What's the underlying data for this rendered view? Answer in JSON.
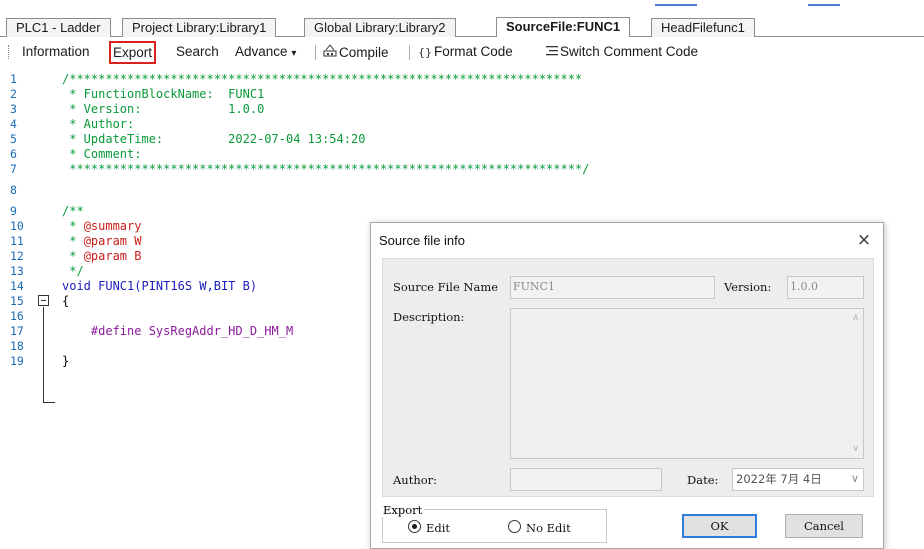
{
  "tabs": [
    {
      "label": "PLC1 - Ladder"
    },
    {
      "label": "Project Library:Library1"
    },
    {
      "label": "Global Library:Library2"
    },
    {
      "label": "SourceFile:FUNC1",
      "active": true
    },
    {
      "label": "HeadFilefunc1"
    }
  ],
  "toolbar": {
    "information": "Information",
    "export": "Export",
    "search": "Search",
    "advance": "Advance",
    "advance_caret": "▾",
    "compile": "Compile",
    "compile_icon": "compile-icon",
    "format_code": "Format Code",
    "format_icon": "format-code-icon",
    "switch_comment": "Switch Comment Code",
    "switch_icon": "switch-comment-icon",
    "highlight_color": "#d9221c"
  },
  "editor": {
    "line_numbers": [
      "1",
      "2",
      "3",
      "4",
      "5",
      "6",
      "7",
      "8",
      "9",
      "10",
      "11",
      "12",
      "13",
      "14",
      "15",
      "16",
      "17",
      "18",
      "19"
    ],
    "lines": [
      "/***********************************************************************",
      " * FunctionBlockName:  FUNC1",
      " * Version:            1.0.0",
      " * Author:",
      " * UpdateTime:         2022-07-04 13:54:20",
      " * Comment:",
      " ***********************************************************************/",
      "",
      "/**",
      " * ",
      " * ",
      " * ",
      " */",
      "void FUNC1(PINT16S W,BIT B)",
      "{",
      "    #define SysRegAddr_HD_D_HM_M",
      "",
      "}",
      ""
    ],
    "doc_tags": {
      "summary": "@summary",
      "param": "@param",
      "param_w": "W",
      "param_b": "B"
    },
    "colors": {
      "comment": "#0a9a3a",
      "tag": "#c8201b",
      "keyword": "#1c1cbf",
      "directive": "#8a1c9a",
      "line_number": "#1a6bb5"
    }
  },
  "dialog": {
    "title": "Source file info",
    "close": "×",
    "source_file_name_label": "Source File Name",
    "source_file_name": "FUNC1",
    "version_label": "Version:",
    "version": "1.0.0",
    "description_label": "Description:",
    "description": "",
    "author_label": "Author:",
    "author": "",
    "date_label": "Date:",
    "date": "2022年 7月 4日",
    "date_caret": "∨",
    "scroll_up": "∧",
    "scroll_down": "∨",
    "export_label": "Export",
    "export_options": [
      {
        "label": "Edit",
        "selected": true
      },
      {
        "label": "No Edit",
        "selected": false
      }
    ],
    "ok": "OK",
    "cancel": "Cancel",
    "ok_border": "#2f7be0"
  }
}
